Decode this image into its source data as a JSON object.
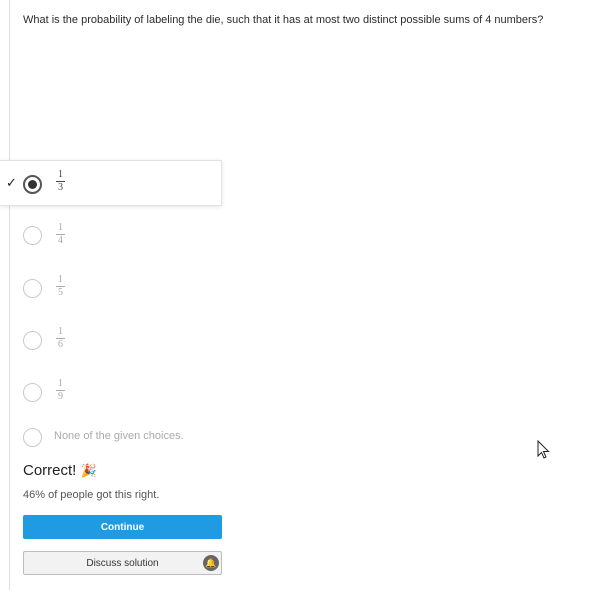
{
  "question": {
    "text": "What is the probability of labeling the die, such that it has at most two distinct possible sums of 4 numbers?"
  },
  "choices": [
    {
      "numerator": "1",
      "denominator": "3",
      "selected": true
    },
    {
      "numerator": "1",
      "denominator": "4",
      "selected": false
    },
    {
      "numerator": "1",
      "denominator": "5",
      "selected": false
    },
    {
      "numerator": "1",
      "denominator": "6",
      "selected": false
    },
    {
      "numerator": "1",
      "denominator": "9",
      "selected": false
    },
    {
      "label": "None of the given choices.",
      "selected": false
    }
  ],
  "feedback": {
    "result": "Correct!",
    "icon": "party-popper-icon",
    "stats": "46% of people got this right."
  },
  "buttons": {
    "continue_label": "Continue",
    "discuss_label": "Discuss solution"
  },
  "colors": {
    "primary": "#1e9be3"
  }
}
